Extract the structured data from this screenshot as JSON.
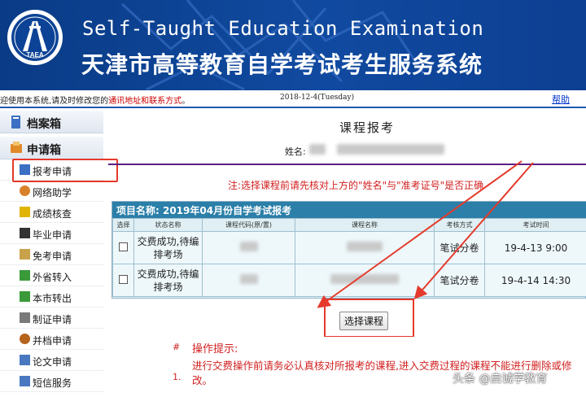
{
  "banner": {
    "title_en": "Self-Taught Education Examination",
    "title_cn": "天津市高等教育自学考试考生服务系统",
    "logo_text": "TAEA"
  },
  "notice": {
    "prefix": "迎使用本系统,请及时修改您的",
    "link": "通讯地址和联系方式",
    "suffix": "。",
    "date": "2018-12-4(Tuesday)",
    "help": "帮助"
  },
  "sidebar": {
    "sections": [
      {
        "label": "档案箱",
        "icon": "archive-icon"
      },
      {
        "label": "申请箱",
        "icon": "apply-box-icon"
      }
    ],
    "items": [
      {
        "label": "报考申请",
        "icon": "form-icon",
        "color": "#3b6fc4"
      },
      {
        "label": "网络助学",
        "icon": "people-icon",
        "color": "#d9812a"
      },
      {
        "label": "成绩核查",
        "icon": "question-icon",
        "color": "#e0b400"
      },
      {
        "label": "毕业申请",
        "icon": "graduation-cap-icon",
        "color": "#333333"
      },
      {
        "label": "免考申请",
        "icon": "pencil-icon",
        "color": "#c8a24a"
      },
      {
        "label": "外省转入",
        "icon": "transfer-in-icon",
        "color": "#3a9a3a"
      },
      {
        "label": "本市转出",
        "icon": "transfer-out-icon",
        "color": "#3a9a3a"
      },
      {
        "label": "制证申请",
        "icon": "certificate-icon",
        "color": "#7a7a7a"
      },
      {
        "label": "并档申请",
        "icon": "merge-people-icon",
        "color": "#b5641c"
      },
      {
        "label": "论文申请",
        "icon": "document-icon",
        "color": "#4a78c0"
      },
      {
        "label": "短信服务",
        "icon": "phone-icon",
        "color": "#4a78c0"
      }
    ]
  },
  "main": {
    "page_title": "课程报考",
    "name_label": "姓名:",
    "warning": "注:选择课程前请先核对上方的\"姓名\"与\"准考证号\"是否正确",
    "project_title": "项目名称: 2019年04月份自学考试报考",
    "table": {
      "headers": [
        "选择",
        "状态名称",
        "课程代码(原/置)",
        "课程名称",
        "考核方式",
        "考试时间"
      ],
      "rows": [
        {
          "status": "交费成功,待编排考场",
          "exam_type": "笔试分卷",
          "exam_time": "19-4-13 9:00"
        },
        {
          "status": "交费成功,待编排考场",
          "exam_type": "笔试分卷",
          "exam_time": "19-4-14 14:30"
        }
      ]
    },
    "select_button": "选择课程",
    "tips": {
      "hash": "#",
      "title": "操作提示:",
      "number": "1.",
      "text": "进行交费操作前请务必认真核对所报考的课程,进入交费过程的课程不能进行删除或修改。"
    }
  },
  "watermark": "头条 @启诚学教育",
  "colors": {
    "banner_blue": "#0d4396",
    "accent_red": "#e53a2b",
    "warning_red": "#d21f1f",
    "table_header": "#2b7fa8",
    "divider_purple": "#5a1f86"
  }
}
